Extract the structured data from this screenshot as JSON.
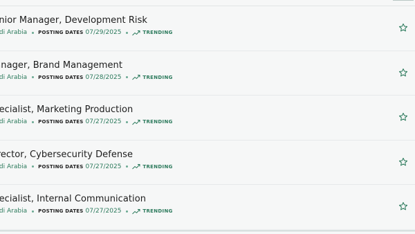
{
  "jobs": [
    {
      "title": "Senior Manager, Development Risk",
      "location": "Saudi Arabia",
      "posting_label": "POSTING DATES",
      "posting_date": "07/29/2025",
      "trend_label": "TRENDING"
    },
    {
      "title": "Manager, Brand Management",
      "location": "Saudi Arabia",
      "posting_label": "POSTING DATES",
      "posting_date": "07/28/2025",
      "trend_label": "TRENDING"
    },
    {
      "title": "Specialist, Marketing Production",
      "location": "Saudi Arabia",
      "posting_label": "POSTING DATES",
      "posting_date": "07/27/2025",
      "trend_label": "TRENDING"
    },
    {
      "title": "Director, Cybersecurity Defense",
      "location": "Saudi Arabia",
      "posting_label": "POSTING DATES",
      "posting_date": "07/27/2025",
      "trend_label": "TRENDING"
    },
    {
      "title": "Specialist, Internal Communication",
      "location": "Saudi Arabia",
      "posting_label": "POSTING DATES",
      "posting_date": "07/27/2025",
      "trend_label": "TRENDING"
    }
  ],
  "icons": {
    "trend": "trending-up-icon",
    "favorite": "star-outline-icon"
  },
  "colors": {
    "accent": "#2c7a5c",
    "title_text": "#1c1c1c",
    "background": "#f6f7f7"
  }
}
